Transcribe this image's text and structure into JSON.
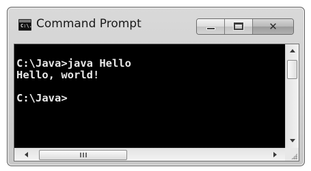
{
  "window": {
    "title": "Command Prompt",
    "icon": "command-prompt-icon",
    "icon_glyph": "C:\\."
  },
  "titlebar": {
    "minimize_icon": "minimize-icon",
    "maximize_icon": "maximize-icon",
    "close_icon": "close-icon",
    "close_glyph": "✕"
  },
  "console": {
    "text": "C:\\Java>java Hello\nHello, world!\n\nC:\\Java>",
    "background": "#000000",
    "foreground": "#e8e8e8"
  },
  "scrollbars": {
    "vertical": {
      "up_icon": "scroll-up-arrow-icon",
      "down_icon": "scroll-down-arrow-icon"
    },
    "horizontal": {
      "left_icon": "scroll-left-arrow-icon",
      "right_icon": "scroll-right-arrow-icon"
    }
  }
}
